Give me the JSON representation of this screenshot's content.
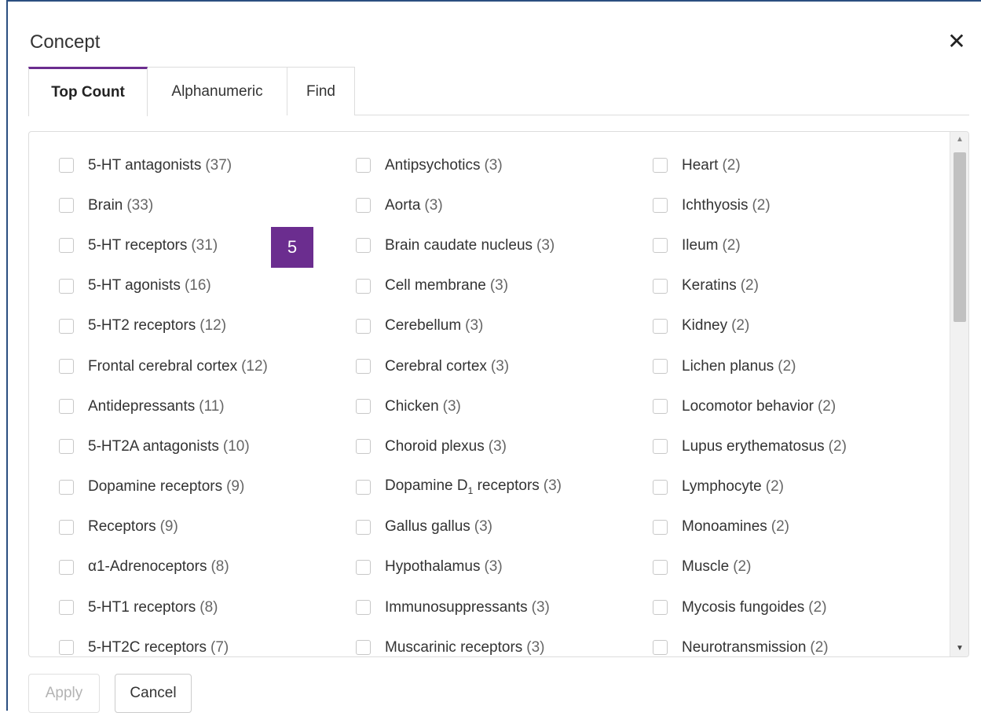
{
  "dialog": {
    "title": "Concept",
    "close_glyph": "✕"
  },
  "tabs": [
    {
      "label": "Top Count",
      "active": true
    },
    {
      "label": "Alphanumeric",
      "active": false
    },
    {
      "label": "Find",
      "active": false
    }
  ],
  "badge": "5",
  "columns": [
    [
      {
        "name": "5-HT antagonists",
        "count": "(37)"
      },
      {
        "name": "Brain",
        "count": "(33)"
      },
      {
        "name": "5-HT receptors",
        "count": "(31)"
      },
      {
        "name": "5-HT agonists",
        "count": "(16)"
      },
      {
        "name": "5-HT2 receptors",
        "count": "(12)"
      },
      {
        "name": "Frontal cerebral cortex",
        "count": "(12)"
      },
      {
        "name": "Antidepressants",
        "count": "(11)"
      },
      {
        "name": "5-HT2A antagonists",
        "count": "(10)"
      },
      {
        "name": "Dopamine receptors",
        "count": "(9)"
      },
      {
        "name": "Receptors",
        "count": "(9)"
      },
      {
        "name": "α1-Adrenoceptors",
        "count": "(8)"
      },
      {
        "name": "5-HT1 receptors",
        "count": "(8)"
      },
      {
        "name": "5-HT2C receptors",
        "count": "(7)"
      }
    ],
    [
      {
        "name": "Antipsychotics",
        "count": "(3)"
      },
      {
        "name": "Aorta",
        "count": "(3)"
      },
      {
        "name": "Brain caudate nucleus",
        "count": "(3)"
      },
      {
        "name": "Cell membrane",
        "count": "(3)"
      },
      {
        "name": "Cerebellum",
        "count": "(3)"
      },
      {
        "name": "Cerebral cortex",
        "count": "(3)"
      },
      {
        "name": "Chicken",
        "count": "(3)"
      },
      {
        "name": "Choroid plexus",
        "count": "(3)"
      },
      {
        "name": "Dopamine D",
        "sub": "1",
        "name_suffix": " receptors",
        "count": "(3)"
      },
      {
        "name": "Gallus gallus",
        "count": "(3)"
      },
      {
        "name": "Hypothalamus",
        "count": "(3)"
      },
      {
        "name": "Immunosuppressants",
        "count": "(3)"
      },
      {
        "name": "Muscarinic receptors",
        "count": "(3)"
      }
    ],
    [
      {
        "name": "Heart",
        "count": "(2)"
      },
      {
        "name": "Ichthyosis",
        "count": "(2)"
      },
      {
        "name": "Ileum",
        "count": "(2)"
      },
      {
        "name": "Keratins",
        "count": "(2)"
      },
      {
        "name": "Kidney",
        "count": "(2)"
      },
      {
        "name": "Lichen planus",
        "count": "(2)"
      },
      {
        "name": "Locomotor behavior",
        "count": "(2)"
      },
      {
        "name": "Lupus erythematosus",
        "count": "(2)"
      },
      {
        "name": "Lymphocyte",
        "count": "(2)"
      },
      {
        "name": "Monoamines",
        "count": "(2)"
      },
      {
        "name": "Muscle",
        "count": "(2)"
      },
      {
        "name": "Mycosis fungoides",
        "count": "(2)"
      },
      {
        "name": "Neurotransmission",
        "count": "(2)"
      }
    ]
  ],
  "scrollbar": {
    "up_glyph": "▲",
    "down_glyph": "▼"
  },
  "footer": {
    "apply_label": "Apply",
    "cancel_label": "Cancel"
  },
  "colors": {
    "accent": "#6b2d8f",
    "window_border": "#2b4f80"
  }
}
